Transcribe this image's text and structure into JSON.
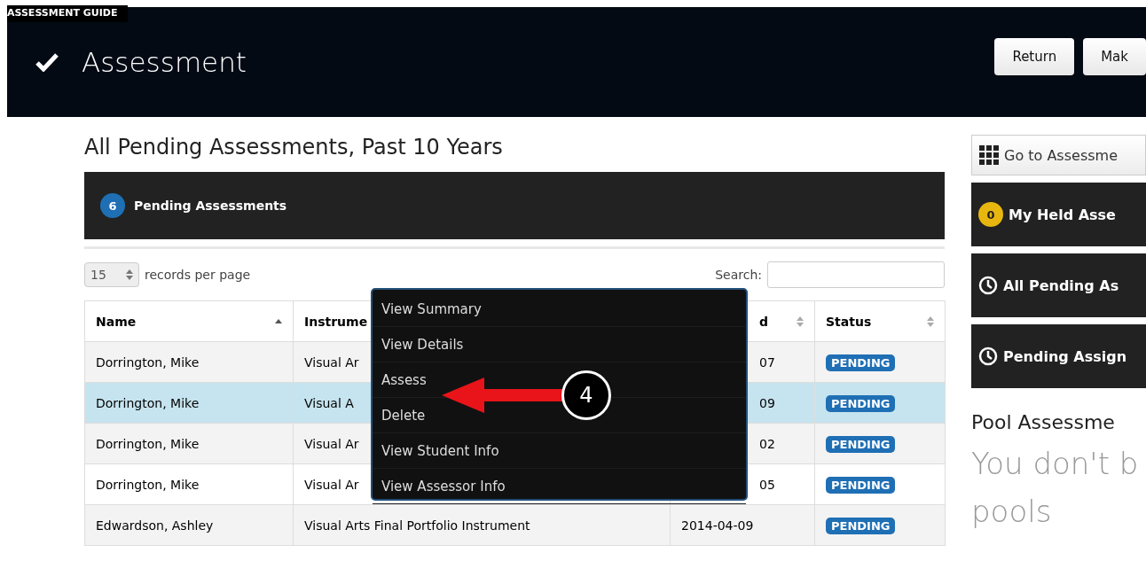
{
  "guide_tag": "ASSESSMENT GUIDE",
  "header": {
    "title": "Assessment",
    "buttons": [
      "Return",
      "Mak"
    ]
  },
  "main": {
    "heading": "All Pending Assessments, Past 10 Years",
    "summary": {
      "count": "6",
      "label": "Pending Assessments"
    },
    "page_size": {
      "value": "15",
      "label": "records per page"
    },
    "search": {
      "label": "Search:"
    },
    "table": {
      "columns": [
        {
          "label": "Name",
          "kind": "sorted"
        },
        {
          "label": "Instrume",
          "kind": "plain"
        },
        {
          "label": "d",
          "kind": "sortable"
        },
        {
          "label": "Status",
          "kind": "sortable"
        }
      ],
      "rows": [
        {
          "name": "Dorrington, Mike",
          "instrument": "Visual Ar",
          "submitted": "07",
          "status": "PENDING",
          "selected": false
        },
        {
          "name": "Dorrington, Mike",
          "instrument": "Visual A",
          "submitted": "09",
          "status": "PENDING",
          "selected": true
        },
        {
          "name": "Dorrington, Mike",
          "instrument": "Visual Ar",
          "submitted": "02",
          "status": "PENDING",
          "selected": false
        },
        {
          "name": "Dorrington, Mike",
          "instrument": "Visual Ar",
          "submitted": "05",
          "status": "PENDING",
          "selected": false
        },
        {
          "name": "Edwardson, Ashley",
          "instrument": "Visual Arts Final Portfolio Instrument",
          "submitted": "2014-04-09",
          "status": "PENDING",
          "selected": false
        }
      ]
    },
    "context_menu": [
      "View Summary",
      "View Details",
      "Assess",
      "Delete",
      "View Student Info",
      "View Assessor Info"
    ],
    "annotation": {
      "step": "4"
    }
  },
  "sidebar": {
    "buttons": [
      {
        "kind": "light",
        "label": "Go to Assessme"
      },
      {
        "kind": "count",
        "count": "0",
        "label": "My Held Asse"
      },
      {
        "kind": "clock",
        "label": "All Pending As"
      },
      {
        "kind": "clock",
        "label": "Pending Assign"
      }
    ],
    "heading": "Pool Assessme",
    "message": "You don't b",
    "message_2": "pools"
  }
}
